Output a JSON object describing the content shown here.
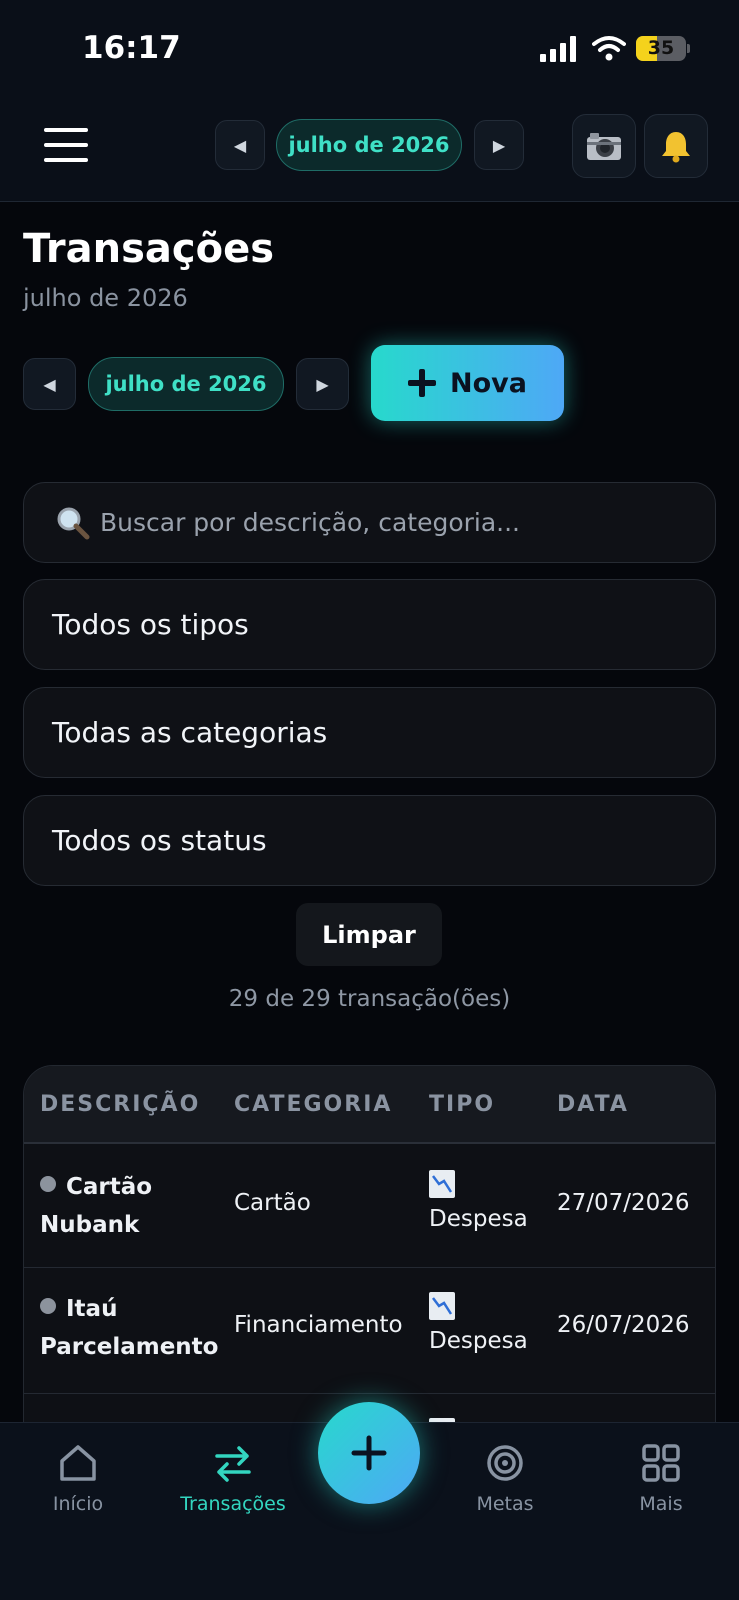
{
  "status_bar": {
    "time": "16:17",
    "battery": "35"
  },
  "header": {
    "month": "julho de 2026",
    "prev_glyph": "◀",
    "next_glyph": "▶",
    "camera_icon": "camera-icon",
    "bell_icon": "bell-icon"
  },
  "page": {
    "title": "Transações",
    "subtitle": "julho de 2026",
    "month": "julho de 2026",
    "prev_glyph": "◀",
    "next_glyph": "▶",
    "new_button": "Nova"
  },
  "filters": {
    "search_placeholder": "Buscar por descrição, categoria...",
    "type": "Todos os tipos",
    "category": "Todas as categorias",
    "status": "Todos os status",
    "clear": "Limpar",
    "count": "29 de 29 transação(ões)"
  },
  "table": {
    "headers": [
      "DESCRIÇÃO",
      "CATEGORIA",
      "TIPO",
      "DATA"
    ],
    "rows": [
      {
        "desc_line1": "Cartão",
        "desc_line2": "Nubank",
        "category": "Cartão",
        "type": "Despesa",
        "date": "27/07/2026"
      },
      {
        "desc_line1": "Itaú",
        "desc_line2": "Parcelamento",
        "category": "Financiamento",
        "type": "Despesa",
        "date": "26/07/2026"
      }
    ]
  },
  "bottom_nav": {
    "items": [
      "Início",
      "Transações",
      "Metas",
      "Mais"
    ]
  },
  "colors": {
    "accent": "#33d6c0",
    "accent_gradient_end": "#4ea8f6",
    "background": "#05070c"
  }
}
